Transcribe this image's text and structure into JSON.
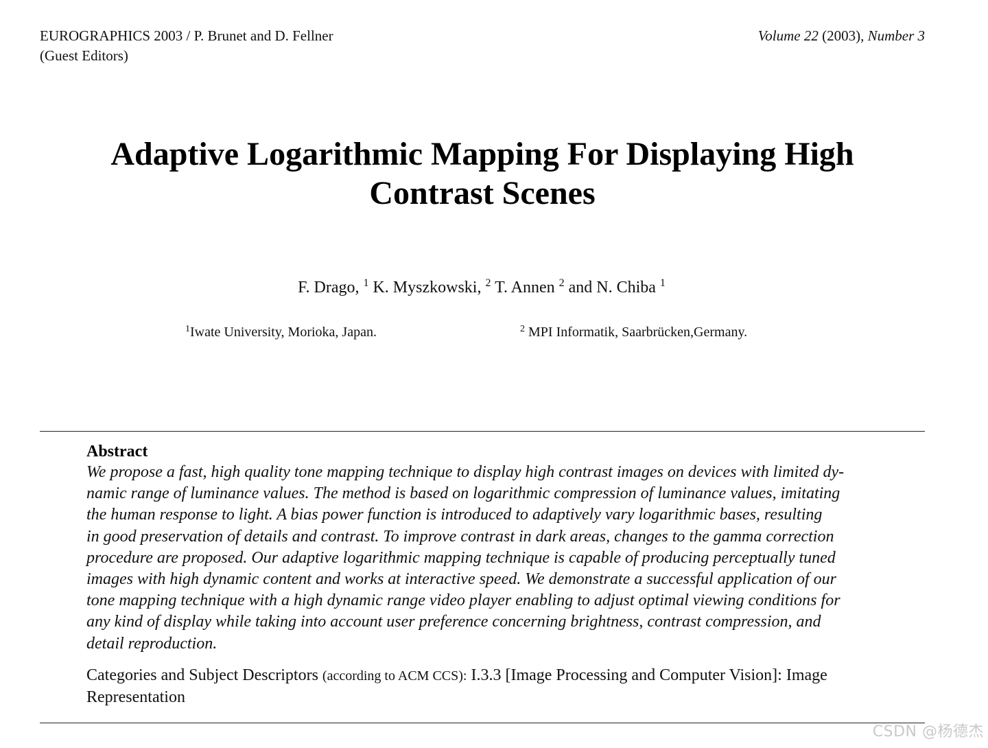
{
  "header": {
    "left_line1": "EUROGRAPHICS 2003 / P. Brunet and D. Fellner",
    "left_line2": "(Guest Editors)",
    "volume_label": "Volume 22",
    "year": "(2003)",
    "number_label": "Number 3"
  },
  "title": {
    "line1": "Adaptive Logarithmic Mapping For Displaying High",
    "line2": "Contrast Scenes"
  },
  "authors": [
    {
      "name": "F. Drago,",
      "sup": "1"
    },
    {
      "name": "K. Myszkowski,",
      "sup": "2"
    },
    {
      "name": "T. Annen",
      "sup": "2"
    },
    {
      "name": "and N. Chiba",
      "sup": "1"
    }
  ],
  "affiliations": [
    {
      "sup": "1",
      "text": "Iwate University, Morioka, Japan."
    },
    {
      "sup": "2",
      "text": "MPI Informatik, Saarbrücken,Germany."
    }
  ],
  "abstract": {
    "heading": "Abstract",
    "lines": [
      "We propose a fast, high quality tone mapping technique to display high contrast images on devices with limited dy-",
      "namic range of luminance values. The method is based on logarithmic compression of luminance values, imitating",
      "the human response to light. A bias power function is introduced to adaptively vary logarithmic bases, resulting",
      "in good preservation of details and contrast. To improve contrast in dark areas, changes to the gamma correction",
      "procedure are proposed. Our adaptive logarithmic mapping technique is capable of producing perceptually tuned",
      "images with high dynamic content and works at interactive speed. We demonstrate a successful application of our",
      "tone mapping technique with a high dynamic range video player enabling to adjust optimal viewing conditions for",
      "any kind of display while taking into account user preference concerning brightness, contrast compression, and",
      "detail reproduction."
    ]
  },
  "categories": {
    "label": "Categories and Subject Descriptors",
    "qualifier": "(according to ACM CCS):",
    "text": "I.3.3 [Image Processing and Computer Vision]: Image Representation"
  },
  "watermark": "CSDN @杨德杰"
}
